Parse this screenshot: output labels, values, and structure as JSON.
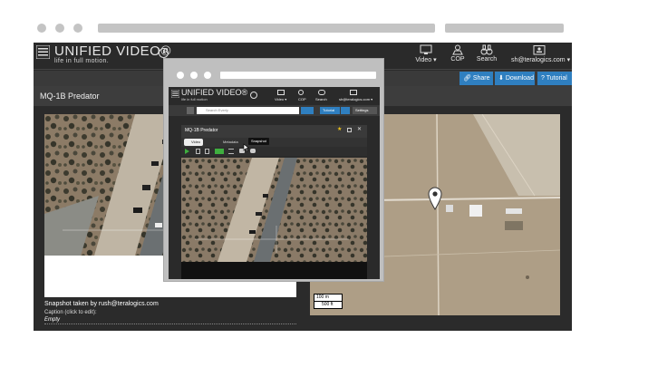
{
  "app": {
    "logo_text": "UNIFIED VIDEO®",
    "tagline": "life in full motion."
  },
  "nav": {
    "video": "Video ▾",
    "cop": "COP",
    "search": "Search",
    "user": "sh@teralogics.com ▾"
  },
  "actions": {
    "share": "Share",
    "download": "Download",
    "tutorial": "Tutorial"
  },
  "page_title": "MQ-1B Predator",
  "snapshot": {
    "taken_by": "Snapshot taken by rush@teralogics.com",
    "caption_hint": "Caption (click to edit):",
    "caption_value": "Empty"
  },
  "map": {
    "scale_m": "100 m",
    "scale_ft": "500 ft"
  },
  "inset": {
    "logo_text": "UNIFIED VIDEO®",
    "tagline": "life in full motion",
    "nav": {
      "video": "Video ▾",
      "cop": "COP",
      "search": "Search",
      "user": "sh@teralogics.com ▾"
    },
    "search_placeholder": "Search Everly",
    "tutorial": "Tutorial",
    "settings": "Settings",
    "panel_title": "MQ-1B Predator",
    "tab_video": "Video",
    "tab_metadata": "Metadata",
    "tooltip": "Snapshot"
  },
  "colors": {
    "accent_blue": "#2f7fc0",
    "play_green": "#3fae3f",
    "star_yellow": "#f0c419"
  }
}
